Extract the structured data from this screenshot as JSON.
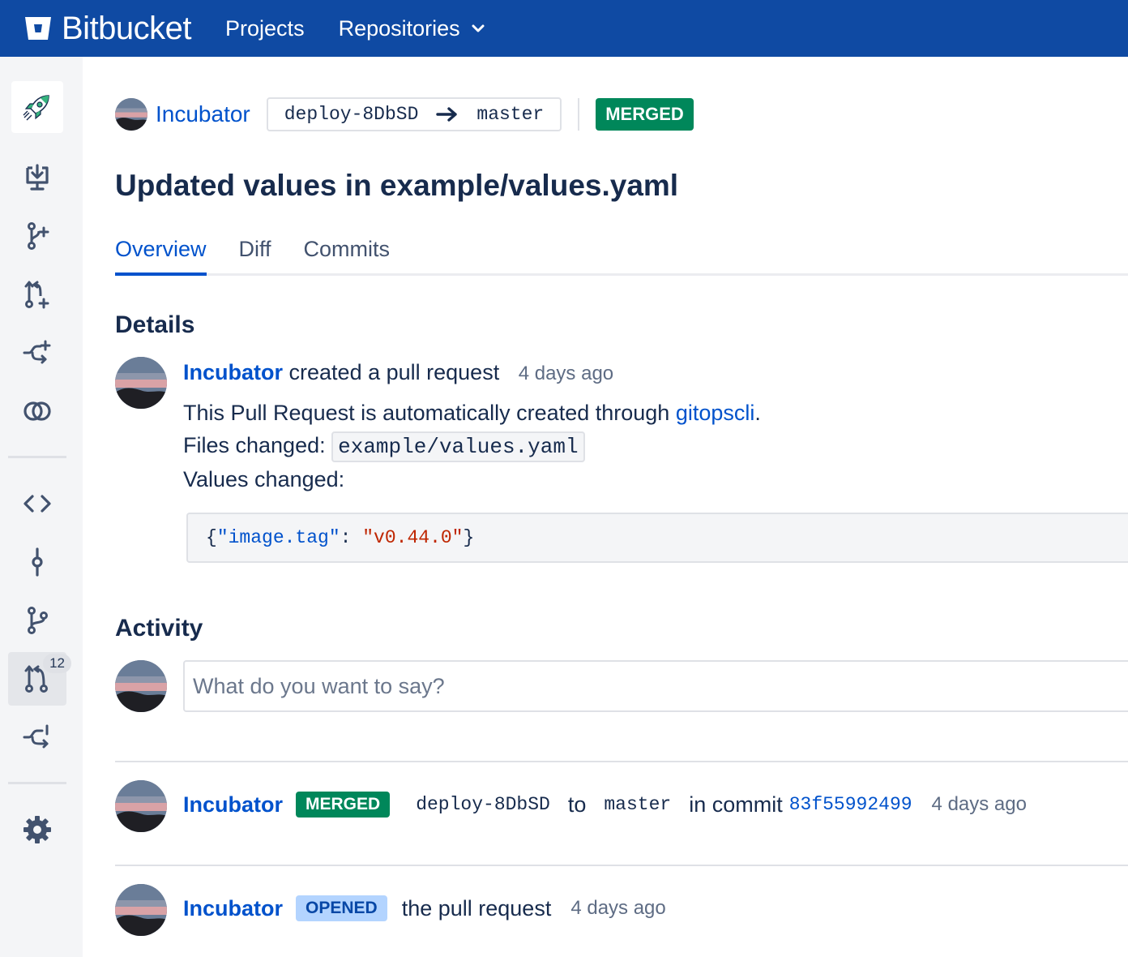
{
  "topbar": {
    "brand": "Bitbucket",
    "nav": [
      {
        "label": "Projects"
      },
      {
        "label": "Repositories"
      }
    ]
  },
  "sidebar": {
    "project_icon": "rocket-icon",
    "items": [
      {
        "name": "clone-icon"
      },
      {
        "name": "create-branch-icon"
      },
      {
        "name": "create-pull-request-icon"
      },
      {
        "name": "create-fork-icon"
      },
      {
        "name": "compare-icon"
      },
      {
        "name": "source-icon"
      },
      {
        "name": "commits-icon"
      },
      {
        "name": "branches-icon"
      },
      {
        "name": "pull-requests-icon",
        "badge": "12",
        "active": true
      },
      {
        "name": "forks-icon"
      },
      {
        "name": "settings-icon"
      }
    ]
  },
  "pr": {
    "repo": "Incubator",
    "source_branch": "deploy-8DbSD",
    "target_branch": "master",
    "status": "MERGED",
    "title": "Updated values in example/values.yaml"
  },
  "tabs": [
    {
      "label": "Overview",
      "active": true
    },
    {
      "label": "Diff"
    },
    {
      "label": "Commits"
    }
  ],
  "details": {
    "heading": "Details",
    "author": "Incubator",
    "action": "created a pull request",
    "time": "4 days ago",
    "desc_prefix": "This Pull Request is automatically created through",
    "desc_link": "gitopscli",
    "desc_suffix": ".",
    "files_label": "Files changed:",
    "files_value": "example/values.yaml",
    "values_label": "Values changed:",
    "code": {
      "open": "{",
      "key": "\"image.tag\"",
      "colon": ": ",
      "value": "\"v0.44.0\"",
      "close": "}"
    }
  },
  "activity": {
    "heading": "Activity",
    "comment_placeholder": "What do you want to say?",
    "events": [
      {
        "author": "Incubator",
        "status": "MERGED",
        "source": "deploy-8DbSD",
        "to": "to",
        "target": "master",
        "in_commit": "in commit",
        "commit": "83f55992499",
        "time": "4 days ago"
      },
      {
        "author": "Incubator",
        "status": "OPENED",
        "text": "the pull request",
        "time": "4 days ago"
      }
    ]
  },
  "colors": {
    "topbar": "#0f4aa3",
    "link": "#0052cc",
    "merged": "#00875a",
    "opened_bg": "#b3d4ff"
  }
}
